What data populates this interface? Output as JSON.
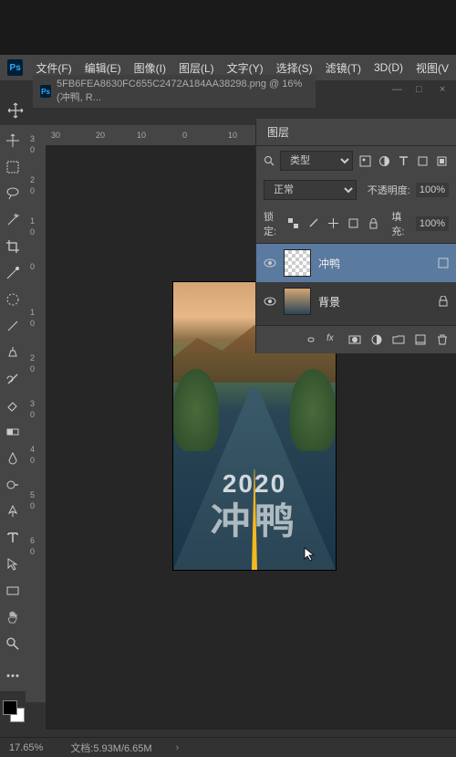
{
  "menu": {
    "items": [
      "文件(F)",
      "编辑(E)",
      "图像(I)",
      "图层(L)",
      "文字(Y)",
      "选择(S)",
      "滤镜(T)",
      "3D(D)",
      "视图(V"
    ]
  },
  "tab": {
    "title": "5FB6FEA8630FC655C2472A184AA38298.png @ 16% (冲鸭, R...",
    "close": "×"
  },
  "rulers": {
    "h": [
      "30",
      "20",
      "10",
      "0",
      "10"
    ],
    "v": [
      "3",
      "0",
      "2",
      "0",
      "1",
      "0",
      "0",
      "1",
      "0",
      "2",
      "0",
      "3",
      "0",
      "4",
      "0",
      "5",
      "0",
      "6",
      "0"
    ]
  },
  "artboard": {
    "year": "2020",
    "chong": "冲鸭"
  },
  "layers": {
    "tab": "图层",
    "filter": "类型",
    "blend": "正常",
    "opacity_label": "不透明度:",
    "opacity_value": "100%",
    "lock_label": "锁定:",
    "fill_label": "填充:",
    "fill_value": "100%",
    "items": [
      {
        "name": "冲鸭"
      },
      {
        "name": "背景"
      }
    ]
  },
  "status": {
    "zoom": "17.65%",
    "doc": "文档:5.93M/6.65M",
    "arrow": "›"
  }
}
